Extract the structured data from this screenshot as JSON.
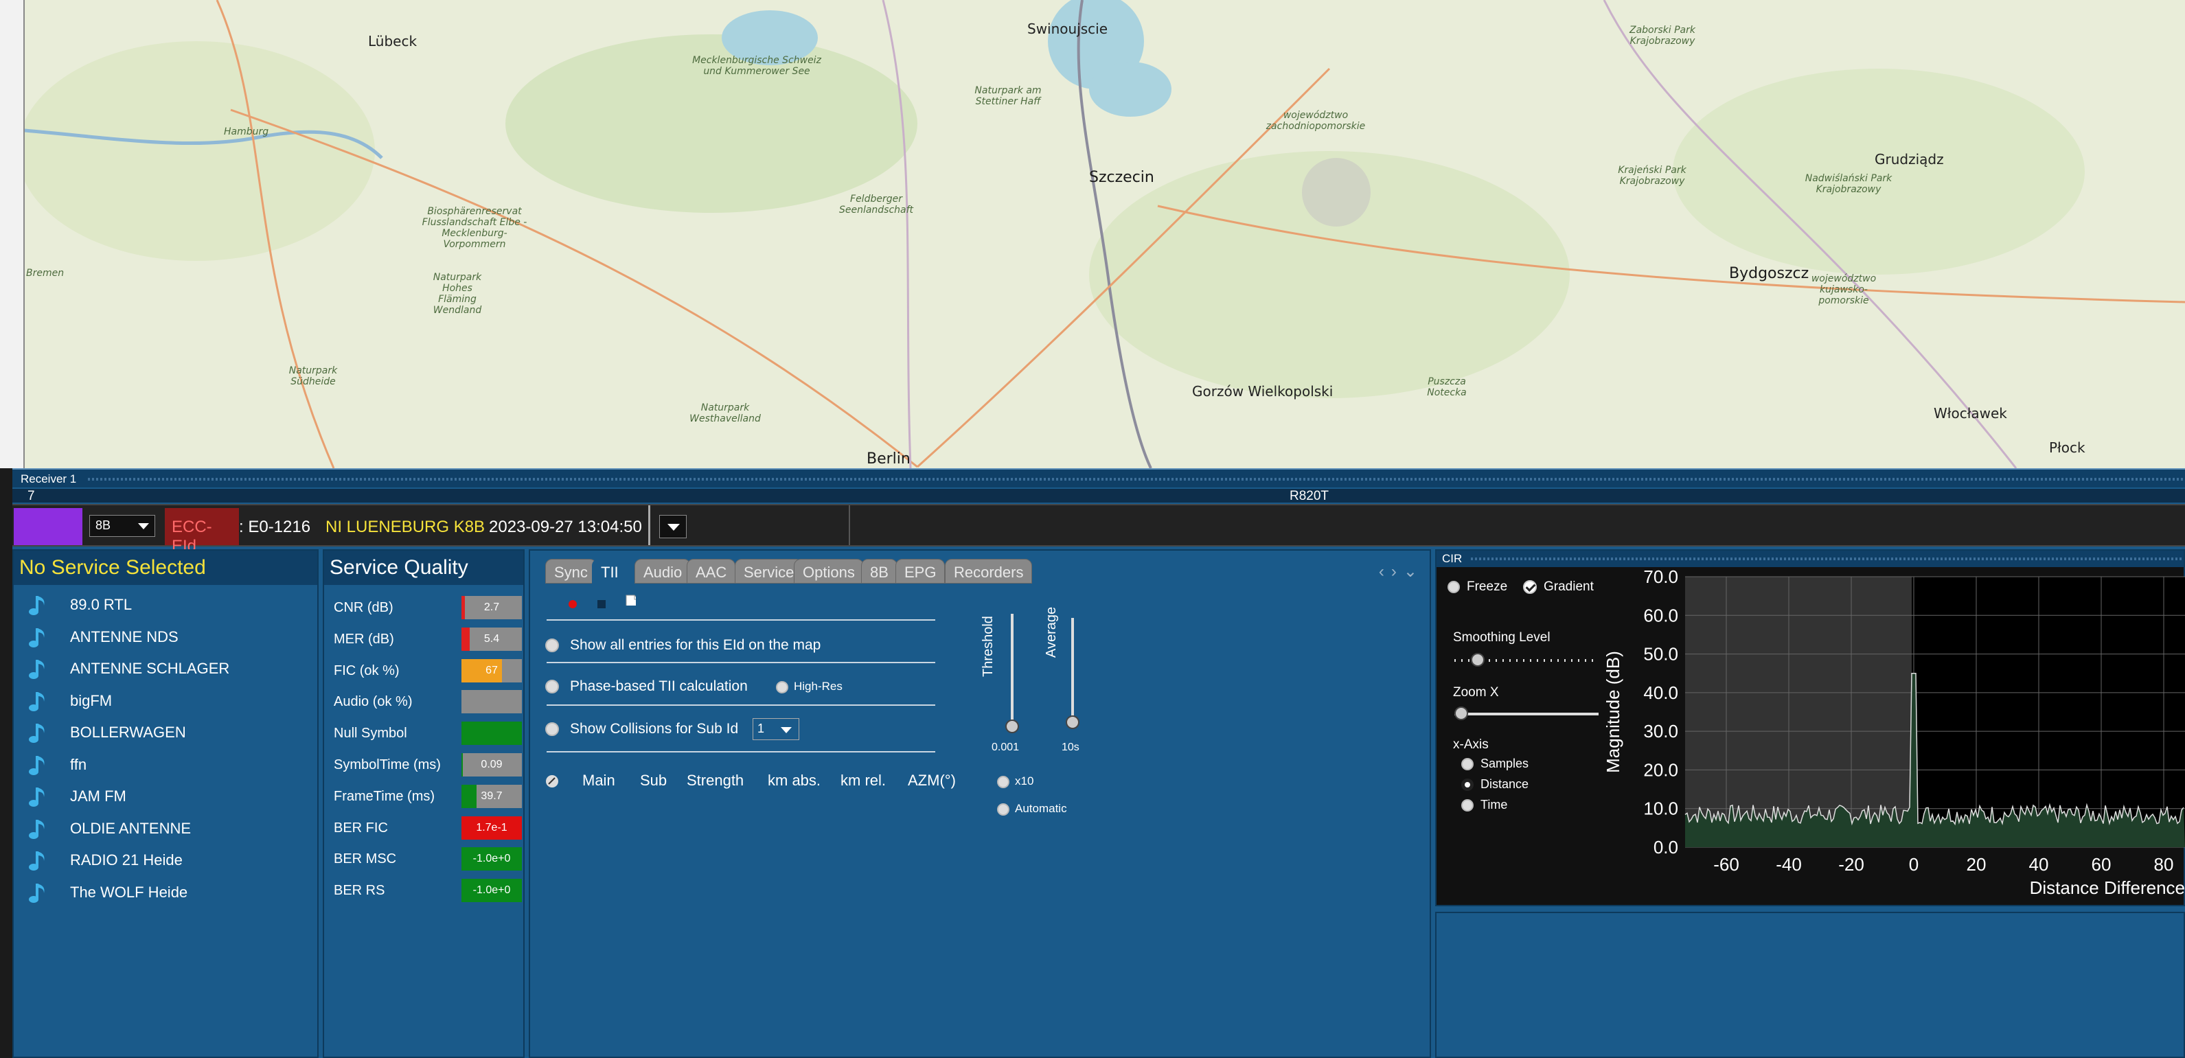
{
  "map": {
    "labels": [
      {
        "text": "Lübeck",
        "cls": "city"
      },
      {
        "text": "Hamburg",
        "cls": "small"
      },
      {
        "text": "Swinoujscie",
        "cls": "city"
      },
      {
        "text": "Szczecin",
        "cls": "big"
      },
      {
        "text": "Bydgoszcz",
        "cls": "big"
      },
      {
        "text": "Berlin",
        "cls": "big"
      },
      {
        "text": "Gorzów Wielkopolski",
        "cls": "city"
      },
      {
        "text": "Grudziądz",
        "cls": "city"
      },
      {
        "text": "Włocławek",
        "cls": "city"
      },
      {
        "text": "Płock",
        "cls": "city"
      },
      {
        "text": "Bremen",
        "cls": "small"
      },
      {
        "text": "Mecklenburgische Schweiz und Kummerower See",
        "cls": "small"
      },
      {
        "text": "Naturpark am Stettiner Haff",
        "cls": "small"
      },
      {
        "text": "województwo zachodniopomorskie",
        "cls": "small"
      },
      {
        "text": "Feldberger Seenlandschaft",
        "cls": "small"
      },
      {
        "text": "Biosphärenreservat Flusslandschaft Elbe - Mecklenburg-Vorpommern",
        "cls": "small"
      },
      {
        "text": "Naturpark Hohes Fläming Wendland",
        "cls": "small"
      },
      {
        "text": "Naturpark Südheide",
        "cls": "small"
      },
      {
        "text": "Naturpark Westhavelland",
        "cls": "small"
      },
      {
        "text": "Puszcza Notecka",
        "cls": "small"
      },
      {
        "text": "Zaborski Park Krajobrazowy",
        "cls": "small"
      },
      {
        "text": "Krajeński Park Krajobrazowy",
        "cls": "small"
      },
      {
        "text": "Nadwiślański Park Krajobrazowy",
        "cls": "small"
      },
      {
        "text": "województwo kujawsko-pomorskie",
        "cls": "small"
      }
    ]
  },
  "receiver": {
    "title": "Receiver 1",
    "index": "7",
    "device": "R820T",
    "color": "#8e2ee0",
    "channel": "8B",
    "ecc_label": "ECC-EId",
    "ecc_value": ": E0-1216",
    "ensemble": "NI LUENEBURG K8B",
    "datetime": "2023-09-27  13:04:50"
  },
  "services": {
    "header": "No Service Selected",
    "items": [
      "89.0 RTL",
      "ANTENNE NDS",
      "ANTENNE SCHLAGER",
      "bigFM",
      "BOLLERWAGEN",
      "ffn",
      "JAM FM",
      "OLDIE ANTENNE",
      "RADIO 21 Heide",
      "The WOLF Heide"
    ]
  },
  "quality": {
    "header": "Service Quality",
    "rows": [
      {
        "label": "CNR (dB)",
        "value": "2.7",
        "fill": 0.06,
        "color": "#e02020"
      },
      {
        "label": "MER (dB)",
        "value": "5.4",
        "fill": 0.14,
        "color": "#e02020"
      },
      {
        "label": "FIC (ok %)",
        "value": "67",
        "fill": 0.67,
        "color": "#f0a020"
      },
      {
        "label": "Audio (ok %)",
        "value": "",
        "fill": 0,
        "color": "#888888"
      },
      {
        "label": "Null Symbol",
        "value": "",
        "fill": 1,
        "color": "#0a8a1a"
      },
      {
        "label": "SymbolTime (ms)",
        "value": "0.09",
        "fill": 0.02,
        "color": "#0a8a1a"
      },
      {
        "label": "FrameTime (ms)",
        "value": "39.7",
        "fill": 0.25,
        "color": "#0a8a1a"
      },
      {
        "label": "BER FIC",
        "value": "1.7e-1",
        "fill": 1,
        "color": "#e01010"
      },
      {
        "label": "BER MSC",
        "value": "-1.0e+0",
        "fill": 1,
        "color": "#0a8a1a"
      },
      {
        "label": "BER RS",
        "value": "-1.0e+0",
        "fill": 1,
        "color": "#0a8a1a"
      }
    ]
  },
  "tabs": {
    "items": [
      "Sync",
      "TII",
      "Audio",
      "AAC",
      "Service",
      "Options",
      "8B",
      "EPG",
      "Recorders"
    ],
    "active": "TII"
  },
  "tii": {
    "show_all": "Show all entries for this EId on the map",
    "phase_based": "Phase-based TII calculation",
    "high_res": "High-Res",
    "collisions": "Show Collisions for Sub Id",
    "sub_id": "1",
    "columns": [
      "Main",
      "Sub",
      "Strength",
      "km abs.",
      "km rel.",
      "AZM(°)"
    ],
    "threshold_label": "Threshold",
    "threshold_value": "0.001",
    "average_label": "Average",
    "average_value": "10s",
    "x10": "x10",
    "automatic": "Automatic"
  },
  "cir": {
    "title": "CIR",
    "freeze": "Freeze",
    "gradient": "Gradient",
    "smoothing": "Smoothing Level",
    "zoom": "Zoom X",
    "xaxis_label": "x-Axis",
    "xaxis_options": [
      "Samples",
      "Distance",
      "Time"
    ],
    "xaxis_selected": "Distance",
    "ylabel": "Magnitude (dB)",
    "xlabel": "Distance Difference",
    "yticks": [
      "70.0",
      "60.0",
      "50.0",
      "40.0",
      "30.0",
      "20.0",
      "10.0",
      "0.0"
    ],
    "xticks": [
      "-60",
      "-40",
      "-20",
      "0",
      "20",
      "40",
      "60",
      "80"
    ]
  }
}
